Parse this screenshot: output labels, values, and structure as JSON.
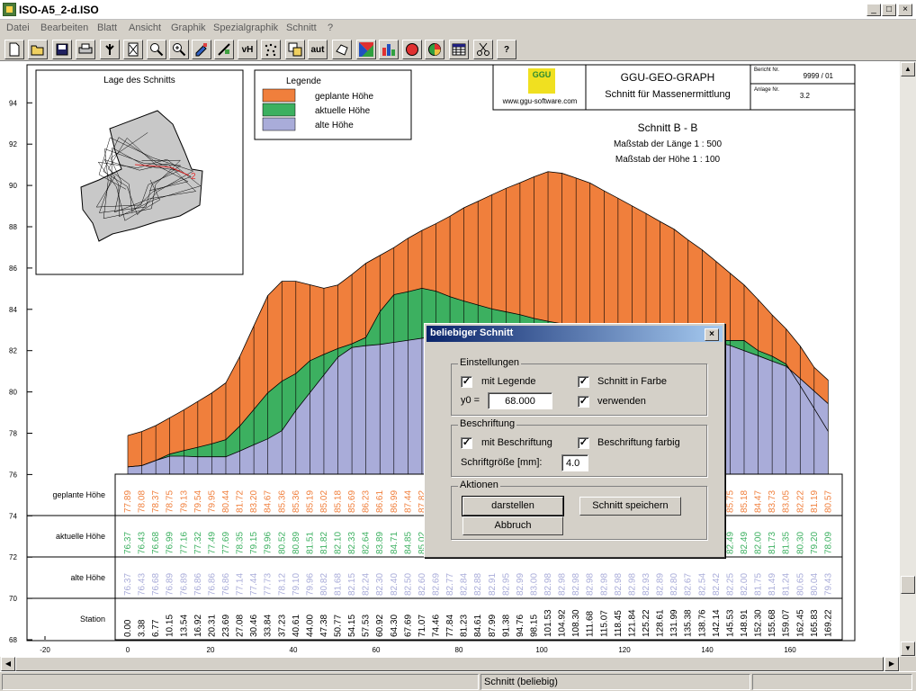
{
  "window": {
    "title": "ISO-A5_2-d.ISO",
    "min": "_",
    "max": "□",
    "close": "×"
  },
  "menu": [
    "Datei",
    "Bearbeiten",
    "Blatt",
    "Ansicht",
    "Graphik",
    "Spezialgraphik",
    "Schnitt",
    "?"
  ],
  "toolbar": {
    "icons": [
      "new-icon",
      "open-icon",
      "save-icon",
      "print-icon",
      "info-icon",
      "page-icon",
      "zoom-icon",
      "zoom-in-icon",
      "pen-icon",
      "line-icon",
      "vh-label",
      "points-icon",
      "copy-icon",
      "aut-label",
      "shape-icon",
      "color-icon",
      "bar-chart-icon",
      "red-circle-icon",
      "pie-icon",
      "table-icon",
      "scissors-icon",
      "help-icon"
    ],
    "vh_label": "vH",
    "aut_label": "aut",
    "help_label": "?"
  },
  "plot": {
    "location_title": "Lage des Schnitts",
    "legend_title": "Legende",
    "legend": [
      {
        "label": "geplante Höhe",
        "color": "#f07f3c"
      },
      {
        "label": "aktuelle Höhe",
        "color": "#3cb060"
      },
      {
        "label": "alte Höhe",
        "color": "#a9acd9"
      }
    ],
    "logo_text": "GGU",
    "website": "www.ggu-software.com",
    "header_title": "GGU-GEO-GRAPH",
    "header_subtitle": "Schnitt für Massenermittlung",
    "bericht_label": "Bericht Nr.",
    "bericht_value": "9999 / 01",
    "anlage_label": "Anlage Nr.",
    "anlage_value": "3.2",
    "section_title": "Schnitt B - B",
    "scale_length": "Maßstab der Länge 1 : 500",
    "scale_height": "Maßstab der Höhe 1 : 100",
    "section_marker": "2",
    "row_labels": {
      "planned": "geplante Höhe",
      "current": "aktuelle Höhe",
      "old": "alte Höhe",
      "station": "Station"
    }
  },
  "chart_data": {
    "type": "area",
    "ylim": [
      68,
      95
    ],
    "xlim": [
      -25,
      175
    ],
    "y_ticks": [
      68,
      70,
      72,
      74,
      76,
      78,
      80,
      82,
      84,
      86,
      88,
      90,
      92,
      94
    ],
    "x_ticks": [
      -20,
      0,
      20,
      40,
      60,
      80,
      100,
      120,
      140,
      160
    ],
    "stations": [
      0.0,
      3.38,
      6.77,
      10.15,
      13.54,
      16.92,
      20.31,
      23.69,
      27.08,
      30.46,
      33.84,
      37.23,
      40.61,
      44.0,
      47.38,
      50.77,
      54.15,
      57.53,
      60.92,
      64.3,
      67.69,
      71.07,
      74.46,
      77.84,
      81.23,
      84.61,
      87.99,
      91.38,
      94.76,
      98.15,
      101.53,
      104.92,
      108.3,
      111.68,
      115.07,
      118.45,
      121.84,
      125.22,
      128.61,
      131.99,
      135.38,
      138.76,
      142.14,
      145.53,
      148.91,
      152.3,
      155.68,
      159.07,
      162.45,
      165.83,
      169.22
    ],
    "series": [
      {
        "name": "geplante Höhe",
        "values": [
          77.89,
          78.08,
          78.37,
          78.75,
          79.13,
          79.54,
          79.95,
          80.44,
          81.72,
          83.2,
          84.67,
          85.36,
          85.36,
          85.19,
          85.02,
          85.18,
          85.69,
          86.23,
          86.61,
          86.99,
          87.44,
          87.82,
          88.15,
          88.51,
          88.92,
          89.23,
          89.55,
          89.86,
          90.13,
          90.42,
          90.67,
          90.59,
          90.36,
          90.12,
          89.74,
          89.38,
          89.01,
          88.64,
          88.25,
          87.88,
          87.36,
          86.88,
          86.32,
          85.75,
          85.18,
          84.47,
          83.73,
          83.05,
          82.22,
          81.19,
          80.57
        ]
      },
      {
        "name": "aktuelle Höhe",
        "values": [
          76.37,
          76.43,
          76.68,
          76.99,
          77.16,
          77.32,
          77.49,
          77.69,
          78.35,
          79.15,
          79.96,
          80.52,
          80.89,
          81.51,
          81.82,
          82.1,
          82.33,
          82.64,
          83.89,
          84.71,
          84.85,
          85.02,
          84.88,
          84.61,
          84.4,
          84.21,
          84.02,
          83.88,
          83.74,
          83.56,
          83.42,
          83.3,
          83.19,
          83.11,
          83.02,
          82.96,
          82.88,
          82.8,
          82.74,
          82.66,
          82.6,
          82.55,
          82.49,
          82.49,
          82.49,
          82.0,
          81.73,
          81.35,
          80.3,
          79.2,
          78.09
        ]
      },
      {
        "name": "alte Höhe",
        "values": [
          76.37,
          76.43,
          76.68,
          76.89,
          76.89,
          76.86,
          76.86,
          76.86,
          77.14,
          77.44,
          77.73,
          78.12,
          79.1,
          79.96,
          80.82,
          81.68,
          82.15,
          82.24,
          82.3,
          82.4,
          82.5,
          82.6,
          82.69,
          82.77,
          82.84,
          82.88,
          82.91,
          82.95,
          82.99,
          83.0,
          82.98,
          82.98,
          82.98,
          82.98,
          82.98,
          82.98,
          82.98,
          82.93,
          82.89,
          82.8,
          82.67,
          82.54,
          82.42,
          82.25,
          82.0,
          81.75,
          81.49,
          81.24,
          80.65,
          80.04,
          79.43
        ]
      }
    ]
  },
  "dialog": {
    "title": "beliebiger Schnitt",
    "close": "×",
    "group_settings": "Einstellungen",
    "mit_legende": "mit Legende",
    "schnitt_in_farbe": "Schnitt in Farbe",
    "y0_label": "y0 =",
    "y0_value": "68.000",
    "verwenden": "verwenden",
    "group_labeling": "Beschriftung",
    "mit_beschriftung": "mit Beschriftung",
    "beschriftung_farbig": "Beschriftung farbig",
    "schriftgroesse_label": "Schriftgröße [mm]:",
    "schriftgroesse_value": "4.0",
    "group_actions": "Aktionen",
    "darstellen": "darstellen",
    "schnitt_speichern": "Schnitt speichern",
    "abbruch": "Abbruch",
    "check_mark": "✓"
  },
  "status": {
    "text": "Schnitt (beliebig)"
  }
}
